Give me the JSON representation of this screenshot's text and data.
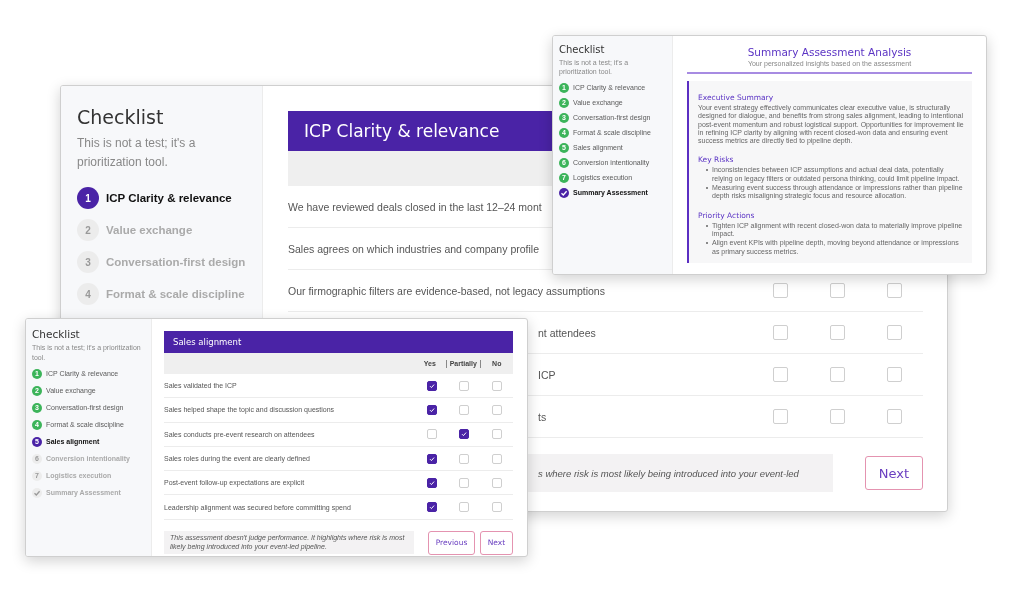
{
  "windows": [
    {
      "kind": "questions",
      "sidebar": {
        "title": "Checklist",
        "subtitle": "This is not a test; it's a prioritization tool.",
        "steps": [
          {
            "number": "1",
            "label": "ICP Clarity & relevance",
            "active": true,
            "done": false
          },
          {
            "number": "2",
            "label": "Value exchange",
            "active": false,
            "done": false
          },
          {
            "number": "3",
            "label": "Conversation-first design",
            "active": false,
            "done": false
          },
          {
            "number": "4",
            "label": "Format & scale discipline",
            "active": false,
            "done": false
          }
        ]
      },
      "header": "ICP Clarity & relevance",
      "rows": [
        {
          "kind": "full",
          "text": "We have reviewed deals closed in the last 12–24 mont"
        },
        {
          "kind": "full",
          "text": "Sales agrees on which industries and company profile"
        },
        {
          "kind": "full",
          "text": "Our firmographic filters are evidence-based, not legacy assumptions",
          "checks": [
            {
              "checked": false
            },
            {
              "checked": false
            },
            {
              "checked": false
            }
          ]
        },
        {
          "kind": "tail",
          "text": "nt attendees",
          "checks": [
            {
              "checked": false
            },
            {
              "checked": false
            },
            {
              "checked": false
            }
          ]
        },
        {
          "kind": "tail",
          "text": "ICP",
          "checks": [
            {
              "checked": false
            },
            {
              "checked": false
            },
            {
              "checked": false
            }
          ]
        },
        {
          "kind": "tail",
          "text": "ts",
          "checks": [
            {
              "checked": false
            },
            {
              "checked": false
            },
            {
              "checked": false
            }
          ]
        }
      ],
      "note": {
        "kind": "tail",
        "text": "s where risk is most likely being introduced into your event-led"
      },
      "buttons": [
        {
          "kind": "next",
          "label": "Next"
        }
      ]
    },
    {
      "kind": "summary",
      "sidebar": {
        "title": "Checklist",
        "subtitle": "This is not a test; it's a prioritization tool.",
        "steps": [
          {
            "number": "1",
            "label": "ICP Clarity & relevance",
            "active": false,
            "done": true
          },
          {
            "number": "2",
            "label": "Value exchange",
            "active": false,
            "done": true
          },
          {
            "number": "3",
            "label": "Conversation-first design",
            "active": false,
            "done": true
          },
          {
            "number": "4",
            "label": "Format & scale discipline",
            "active": false,
            "done": true
          },
          {
            "number": "5",
            "label": "Sales alignment",
            "active": false,
            "done": true
          },
          {
            "number": "6",
            "label": "Conversion intentionality",
            "active": false,
            "done": true
          },
          {
            "number": "7",
            "label": "Logistics execution",
            "active": false,
            "done": true
          },
          {
            "label": "Summary Assessment",
            "active": true,
            "done": false
          }
        ]
      },
      "title": "Summary Assessment Analysis",
      "subtitle": "Your personalized insights based on the assessment",
      "sections": [
        {
          "heading": "Executive Summary",
          "paragraph": "Your event strategy effectively communicates clear executive value, is structurally designed for dialogue, and benefits from strong sales alignment, leading to intentional post-event momentum and robust logistical support. Opportunities for improvement lie in refining ICP clarity by aligning with recent closed-won data and ensuring event success metrics are directly tied to pipeline depth."
        },
        {
          "heading": "Key Risks",
          "bullets": [
            "Inconsistencies between ICP assumptions and actual deal data, potentially relying on legacy filters or outdated persona thinking, could limit pipeline impact.",
            "Measuring event success through attendance or impressions rather than pipeline depth risks misaligning strategic focus and resource allocation."
          ]
        },
        {
          "heading": "Priority Actions",
          "bullets": [
            "Tighten ICP alignment with recent closed-won data to materially improve pipeline impact.",
            "Align event KPIs with pipeline depth, moving beyond attendance or impressions as primary success metrics."
          ]
        }
      ]
    },
    {
      "kind": "questions",
      "sidebar": {
        "title": "Checklist",
        "subtitle": "This is not a test; it's a prioritization tool.",
        "steps": [
          {
            "number": "1",
            "label": "ICP Clarity & relevance",
            "active": false,
            "done": true
          },
          {
            "number": "2",
            "label": "Value exchange",
            "active": false,
            "done": true
          },
          {
            "number": "3",
            "label": "Conversation-first design",
            "active": false,
            "done": true
          },
          {
            "number": "4",
            "label": "Format & scale discipline",
            "active": false,
            "done": true
          },
          {
            "number": "5",
            "label": "Sales alignment",
            "active": true,
            "done": false
          },
          {
            "number": "6",
            "label": "Conversion intentionality",
            "active": false,
            "done": false
          },
          {
            "number": "7",
            "label": "Logistics execution",
            "active": false,
            "done": false
          },
          {
            "label": "Summary Assessment",
            "active": false,
            "done": false
          }
        ]
      },
      "header": "Sales alignment",
      "columns": [
        "Yes",
        "Partially",
        "No"
      ],
      "rows": [
        {
          "kind": "full",
          "text": "Sales validated the ICP",
          "checks": [
            {
              "checked": true
            },
            {
              "checked": false
            },
            {
              "checked": false
            }
          ]
        },
        {
          "kind": "full",
          "text": "Sales helped shape the topic and discussion questions",
          "checks": [
            {
              "checked": true
            },
            {
              "checked": false
            },
            {
              "checked": false
            }
          ]
        },
        {
          "kind": "full",
          "text": "Sales conducts pre-event research on attendees",
          "checks": [
            {
              "checked": false
            },
            {
              "checked": true
            },
            {
              "checked": false
            }
          ]
        },
        {
          "kind": "full",
          "text": "Sales roles during the event are clearly defined",
          "checks": [
            {
              "checked": true
            },
            {
              "checked": false
            },
            {
              "checked": false
            }
          ]
        },
        {
          "kind": "full",
          "text": "Post-event follow-up expectations are explicit",
          "checks": [
            {
              "checked": true
            },
            {
              "checked": false
            },
            {
              "checked": false
            }
          ]
        },
        {
          "kind": "full",
          "text": "Leadership alignment was secured before committing spend",
          "checks": [
            {
              "checked": true
            },
            {
              "checked": false
            },
            {
              "checked": false
            }
          ]
        }
      ],
      "note": {
        "kind": "full",
        "text": "This assessment doesn't judge performance. It highlights where risk is most likely being introduced into your event-led pipeline."
      },
      "buttons": [
        {
          "kind": "previous",
          "label": "Previous"
        },
        {
          "kind": "next",
          "label": "Next"
        }
      ]
    }
  ]
}
